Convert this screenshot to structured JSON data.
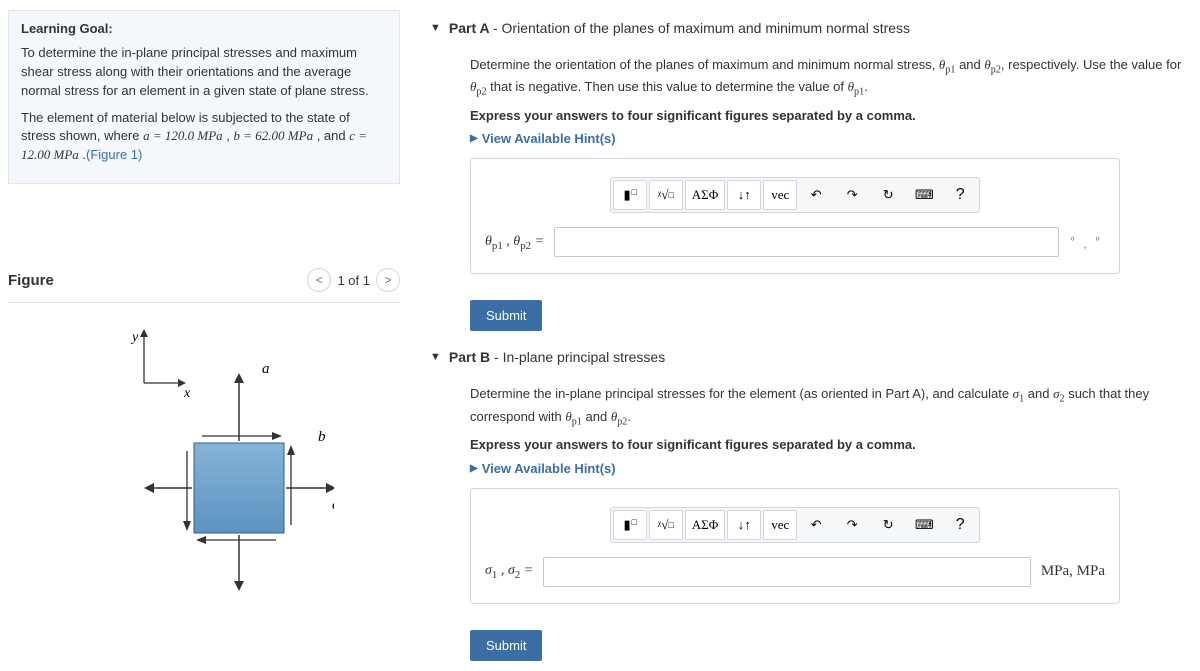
{
  "learning_goal": {
    "heading": "Learning Goal:",
    "para1": "To determine the in-plane principal stresses and maximum shear stress along with their orientations and the average normal stress for an element in a given state of plane stress.",
    "para2_pre": "The element of material below is subjected to the state of stress shown, where ",
    "a_expr": "a = 120.0 MPa",
    "b_expr": "b = 62.00 MPa",
    "c_expr": "c = 12.00 MPa",
    "figlink": "(Figure 1)"
  },
  "figure": {
    "heading": "Figure",
    "counter": "1 of 1",
    "labels": {
      "y": "y",
      "x": "x",
      "a": "a",
      "b": "b",
      "c": "c"
    }
  },
  "partA": {
    "title_bold": "Part A ",
    "title_rest": "- Orientation of the planes of maximum and minimum normal stress",
    "prompt_pre": "Determine the orientation of the planes of maximum and minimum normal stress, ",
    "theta_p1": "θp1",
    "and": " and ",
    "theta_p2": "θp2",
    "prompt_mid": ", respectively. Use the value for ",
    "prompt_mid2": " that is negative. Then use this value to determine the value of ",
    "period": ".",
    "instruction": "Express your answers to four significant figures separated by a comma.",
    "hints": "View Available Hint(s)",
    "input_label": "θp1 , θp2 =",
    "unit_tail": ""
  },
  "partB": {
    "title_bold": "Part B ",
    "title_rest": "- In-plane principal stresses",
    "prompt_pre": "Determine the in-plane principal stresses for the element (as oriented in Part A), and calculate ",
    "sigma1": "σ1",
    "and": " and ",
    "sigma2": "σ2",
    "prompt_mid": " such that they correspond with ",
    "theta_p1": "θp1",
    "theta_p2": "θp2",
    "period": ".",
    "instruction": "Express your answers to four significant figures separated by a comma.",
    "hints": "View Available Hint(s)",
    "input_label": "σ1 , σ2 =",
    "unit_tail": "MPa, MPa"
  },
  "toolbar": {
    "templates": "▮",
    "sqrt": "√",
    "greek": "ΑΣΦ",
    "subsup": "↓↑",
    "vec": "vec",
    "undo_glyph": "↶",
    "redo_glyph": "↷",
    "reset_glyph": "↻",
    "keyboard_glyph": "⌨",
    "help_glyph": "?"
  },
  "submit": "Submit"
}
